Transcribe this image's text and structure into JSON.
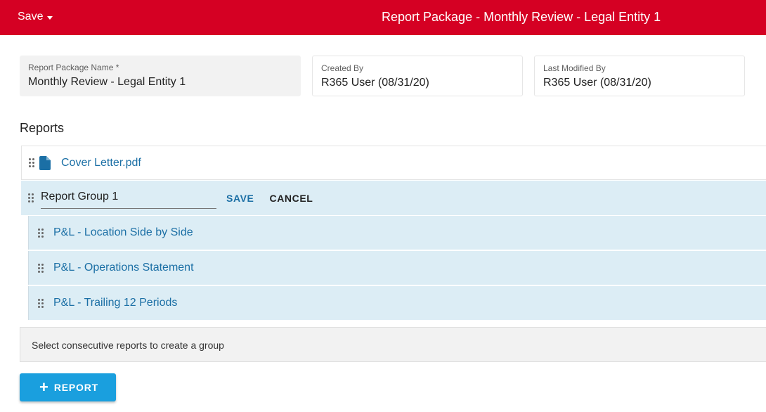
{
  "header": {
    "save_label": "Save",
    "title": "Report Package - Monthly Review - Legal Entity 1"
  },
  "fields": {
    "name": {
      "label": "Report Package Name *",
      "value": "Monthly Review - Legal Entity 1"
    },
    "created_by": {
      "label": "Created By",
      "value": "R365 User (08/31/20)"
    },
    "last_modified_by": {
      "label": "Last Modified By",
      "value": "R365 User (08/31/20)"
    }
  },
  "reports": {
    "title": "Reports",
    "file": {
      "name": "Cover Letter.pdf",
      "icon": "file-icon"
    },
    "group": {
      "name_value": "Report Group 1",
      "save_label": "SAVE",
      "cancel_label": "CANCEL",
      "items": [
        {
          "name": "P&L - Location Side by Side"
        },
        {
          "name": "P&L - Operations Statement"
        },
        {
          "name": "P&L - Trailing 12 Periods"
        }
      ]
    },
    "hint": "Select consecutive reports to create a group",
    "add_button": {
      "icon": "plus-icon",
      "label": "REPORT"
    }
  },
  "colors": {
    "header_bg": "#d50023",
    "link": "#1b6fa5",
    "group_bg": "#dcedf5",
    "primary_button": "#1a9fde"
  }
}
